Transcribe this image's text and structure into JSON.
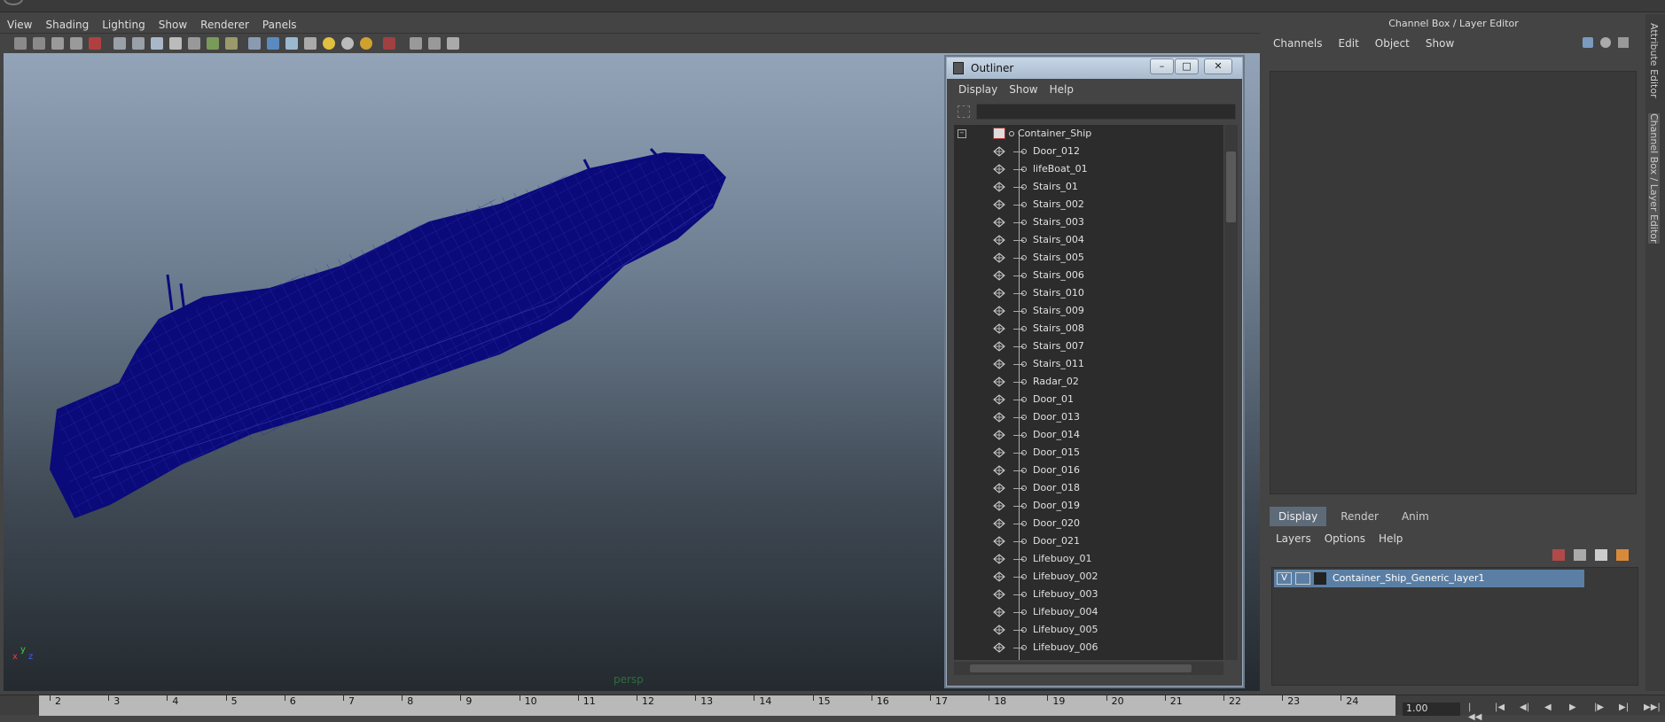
{
  "viewport": {
    "menu": [
      "View",
      "Shading",
      "Lighting",
      "Show",
      "Renderer",
      "Panels"
    ],
    "camera_label": "persp"
  },
  "outliner": {
    "title": "Outliner",
    "menu": [
      "Display",
      "Show",
      "Help"
    ],
    "root": "Container_Ship",
    "items": [
      "Door_012",
      "lifeBoat_01",
      "Stairs_01",
      "Stairs_002",
      "Stairs_003",
      "Stairs_004",
      "Stairs_005",
      "Stairs_006",
      "Stairs_010",
      "Stairs_009",
      "Stairs_008",
      "Stairs_007",
      "Stairs_011",
      "Radar_02",
      "Door_01",
      "Door_013",
      "Door_014",
      "Door_015",
      "Door_016",
      "Door_018",
      "Door_019",
      "Door_020",
      "Door_021",
      "Lifebuoy_01",
      "Lifebuoy_002",
      "Lifebuoy_003",
      "Lifebuoy_004",
      "Lifebuoy_005",
      "Lifebuoy_006"
    ]
  },
  "channel_box": {
    "title": "Channel Box / Layer Editor",
    "menu": [
      "Channels",
      "Edit",
      "Object",
      "Show"
    ],
    "tabs": [
      "Display",
      "Render",
      "Anim"
    ],
    "active_tab": "Display",
    "layer_menu": [
      "Layers",
      "Options",
      "Help"
    ],
    "layer": {
      "visible": "V",
      "name": "Container_Ship_Generic_layer1"
    }
  },
  "side_tabs": [
    "Attribute Editor",
    "Channel Box / Layer Editor"
  ],
  "timeline": {
    "ticks": [
      "2",
      "3",
      "4",
      "5",
      "6",
      "7",
      "8",
      "9",
      "10",
      "11",
      "12",
      "13",
      "14",
      "15",
      "16",
      "17",
      "18",
      "19",
      "20",
      "21",
      "22",
      "23",
      "24"
    ],
    "current_frame": "1.00"
  },
  "axis_labels": {
    "x": "x",
    "y": "y",
    "z": "z"
  }
}
